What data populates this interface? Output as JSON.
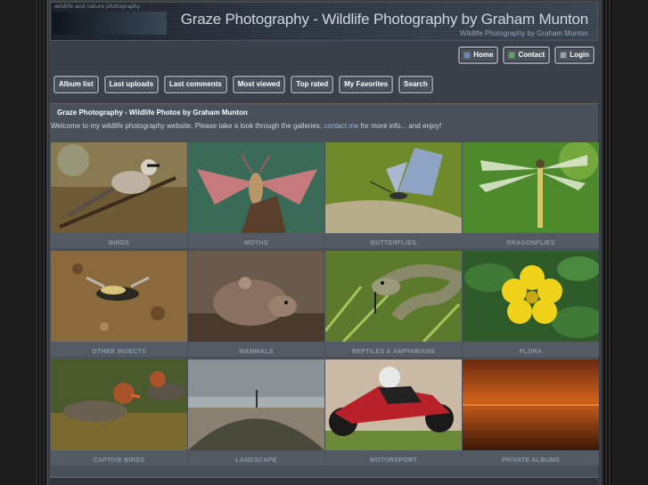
{
  "header": {
    "tagline_top": "wildlife and nature photography",
    "title": "Graze Photography - Wildlife Photography by Graham Munton",
    "subtitle": "Wildlife Photography by Graham Munton"
  },
  "topnav": [
    {
      "label": "Home",
      "icon": "home-icon"
    },
    {
      "label": "Contact",
      "icon": "contact-icon"
    },
    {
      "label": "Login",
      "icon": "login-icon"
    }
  ],
  "menu": [
    "Album list",
    "Last uploads",
    "Last comments",
    "Most viewed",
    "Top rated",
    "My Favorites",
    "Search"
  ],
  "content": {
    "title": "Graze Photography - Wildlife Photos by Graham Munton",
    "welcome_before": "Welcome to my wildlife photography website. Please take a look through the galleries,",
    "welcome_link": "contact me",
    "welcome_after": "for more info... and enjoy!"
  },
  "albums": [
    "BIRDS",
    "MOTHS",
    "BUTTERFLIES",
    "DRAGONFLIES",
    "OTHER INSECTS",
    "MAMMALS",
    "REPTILES & AMPHIBIANS",
    "FLORA",
    "CAPTIVE BIRDS",
    "LANDSCAPE",
    "MOTORSPORT",
    "PRIVATE ALBUMS"
  ]
}
